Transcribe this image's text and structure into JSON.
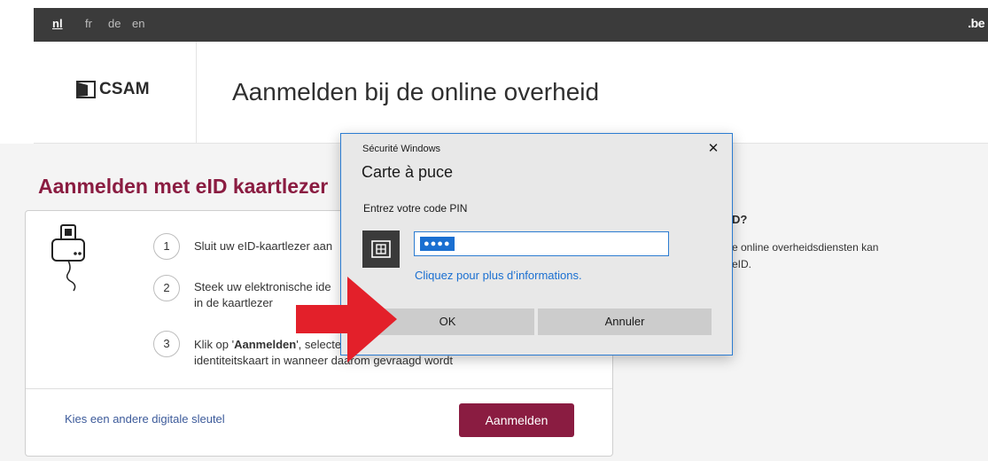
{
  "languages": [
    {
      "code": "nl",
      "active": true
    },
    {
      "code": "fr",
      "active": false
    },
    {
      "code": "de",
      "active": false
    },
    {
      "code": "en",
      "active": false
    }
  ],
  "be_logo": ".be",
  "header": {
    "logo_text": "CSAM",
    "title": "Aanmelden bij de online overheid"
  },
  "section": {
    "title": "Aanmelden met eID kaartlezer"
  },
  "steps": [
    {
      "number": "1",
      "text": "Sluit uw eID-kaartlezer aan"
    },
    {
      "number": "2",
      "text_line1": "Steek uw elektronische ide",
      "text_line2": "in de kaartlezer"
    },
    {
      "number": "3",
      "prefix": "Klik op '",
      "bold": "Aanmelden",
      "suffix": "', selecte",
      "text_line2": "identiteitskaart in wanneer daarom gevraagd wordt"
    }
  ],
  "card_footer": {
    "other_key_link": "Kies een andere digitale sleutel",
    "login_button": "Aanmelden"
  },
  "side_info": {
    "heading": "D?",
    "text_line1": "e online overheidsdiensten kan",
    "text_line2": "eID."
  },
  "dialog": {
    "window_title": "Sécurité Windows",
    "close_glyph": "✕",
    "heading": "Carte à puce",
    "prompt": "Entrez votre code PIN",
    "pin_masked": "●●●●",
    "info_link": "Cliquez pour plus d’informations.",
    "ok_button": "OK",
    "cancel_button": "Annuler"
  },
  "colors": {
    "topbar": "#3b3b3b",
    "brand_burgundy": "#8a1c41",
    "dialog_border": "#2c7cd1",
    "annotation_arrow": "#e3202a"
  }
}
